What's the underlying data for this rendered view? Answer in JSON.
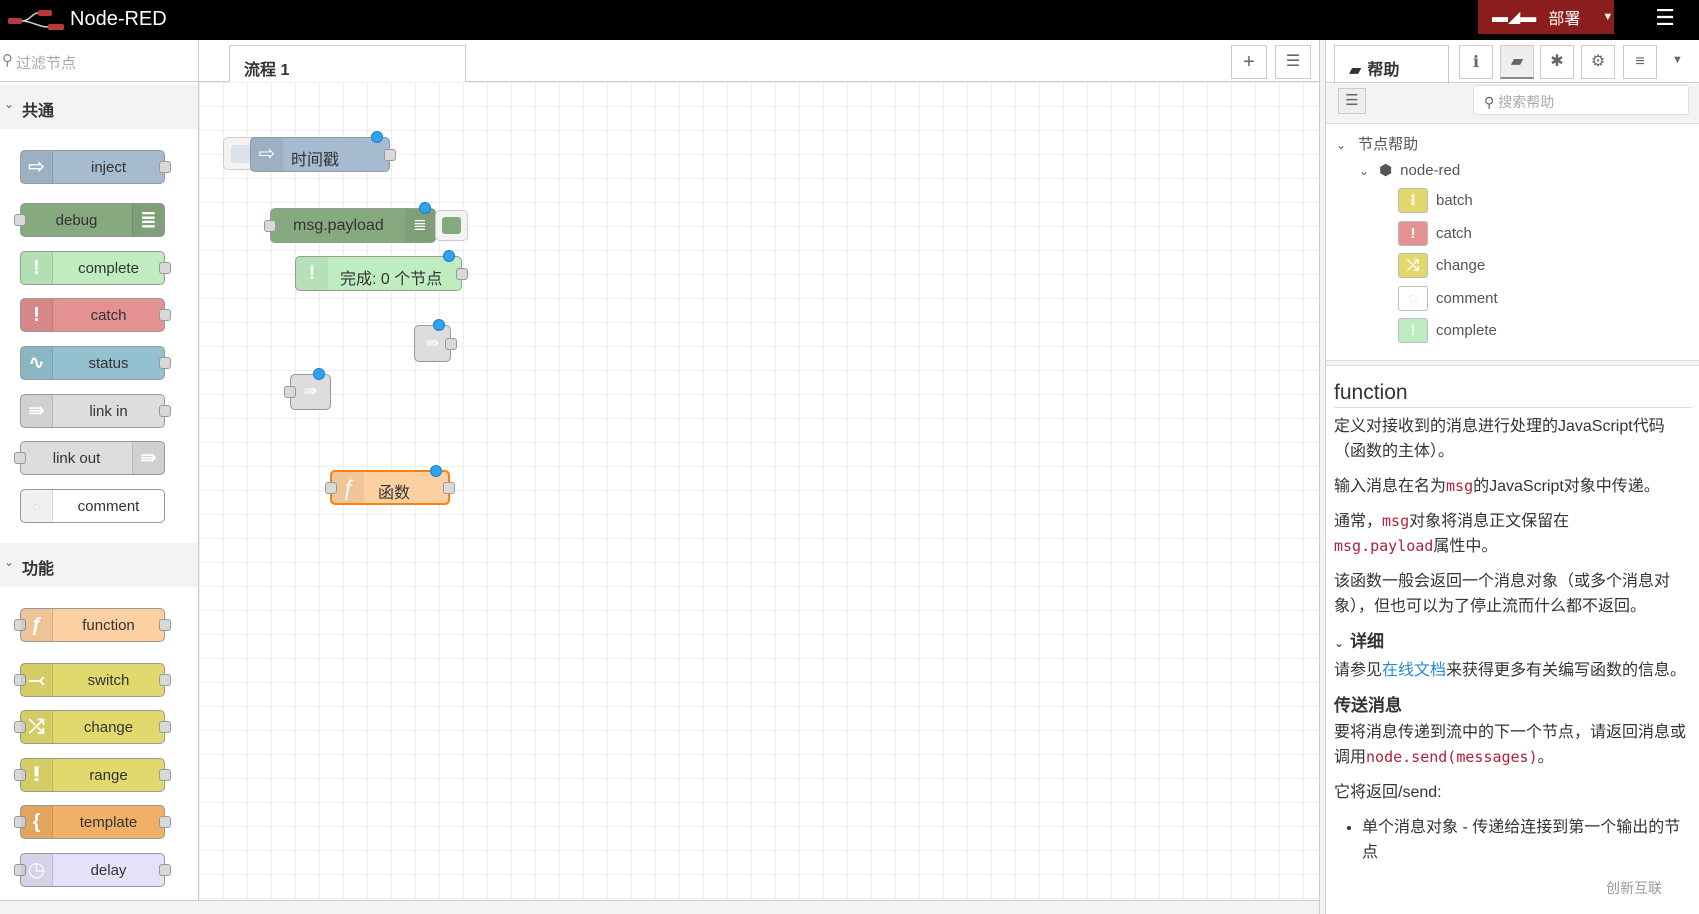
{
  "header": {
    "title": "Node-RED",
    "deploy_label": "部署",
    "accent": "#8c1d1d"
  },
  "palette": {
    "filter_placeholder": "过滤节点",
    "categories": [
      {
        "label": "共通",
        "nodes": [
          {
            "label": "inject",
            "color": "#a6bbcf",
            "icon": "arrow-right-icon"
          },
          {
            "label": "debug",
            "color": "#87a980",
            "icon": "list-icon"
          },
          {
            "label": "complete",
            "color": "#c0edc0",
            "icon": "exclamation-icon"
          },
          {
            "label": "catch",
            "color": "#e49191",
            "icon": "exclamation-icon"
          },
          {
            "label": "status",
            "color": "#94c1d0",
            "icon": "pulse-icon"
          },
          {
            "label": "link in",
            "color": "#dddddd",
            "icon": "link-in-icon"
          },
          {
            "label": "link out",
            "color": "#dddddd",
            "icon": "link-out-icon"
          },
          {
            "label": "comment",
            "color": "#ffffff",
            "icon": "comment-icon"
          }
        ]
      },
      {
        "label": "功能",
        "nodes": [
          {
            "label": "function",
            "color": "#fdd0a2",
            "icon": "function-icon"
          },
          {
            "label": "switch",
            "color": "#e2d96e",
            "icon": "switch-icon"
          },
          {
            "label": "change",
            "color": "#e2d96e",
            "icon": "shuffle-icon"
          },
          {
            "label": "range",
            "color": "#e2d96e",
            "icon": "range-icon"
          },
          {
            "label": "template",
            "color": "#f0b065",
            "icon": "brace-icon"
          },
          {
            "label": "delay",
            "color": "#e6e0f8",
            "icon": "timer-icon"
          }
        ]
      }
    ]
  },
  "workspace": {
    "tab": "流程 1",
    "nodes": [
      {
        "label": "时间戳",
        "type": "inject"
      },
      {
        "label": "msg.payload",
        "type": "debug"
      },
      {
        "label": "完成: 0 个节点",
        "type": "complete"
      },
      {
        "label": "",
        "type": "link out"
      },
      {
        "label": "",
        "type": "link in"
      },
      {
        "label": "函数",
        "type": "function"
      }
    ]
  },
  "sidebar": {
    "tab_label": "帮助",
    "search_placeholder": "搜索帮助",
    "tree": {
      "root": "节点帮助",
      "module": "node-red",
      "items": [
        {
          "label": "batch",
          "color": "#e2d96e"
        },
        {
          "label": "catch",
          "color": "#e49191"
        },
        {
          "label": "change",
          "color": "#e2d96e"
        },
        {
          "label": "comment",
          "color": "#ffffff"
        },
        {
          "label": "complete",
          "color": "#c0edc0"
        }
      ]
    },
    "doc": {
      "title": "function",
      "p1": "定义对接收到的消息进行处理的JavaScript代码（函数的主体）。",
      "p2a": "输入消息在名为",
      "p2code": "msg",
      "p2b": "的JavaScript对象中传递。",
      "p3a": "通常，",
      "p3code": "msg",
      "p3b": "对象将消息正文保留在",
      "p3code2": "msg.payload",
      "p3c": "属性中。",
      "p4": "该函数一般会返回一个消息对象（或多个消息对象），但也可以为了停止流而什么都不返回。",
      "details": "详细",
      "p5a": "请参见",
      "p5link": "在线文档",
      "p5b": "来获得更多有关编写函数的信息。",
      "h_send": "传送消息",
      "p6a": "要将消息传递到流中的下一个节点，请返回消息或调用",
      "p6code": "node.send(messages)",
      "p6b": "。",
      "p7": "它将返回/send:",
      "li1": "单个消息对象 - 传递给连接到第一个输出的节点"
    }
  },
  "watermark": "创新互联"
}
